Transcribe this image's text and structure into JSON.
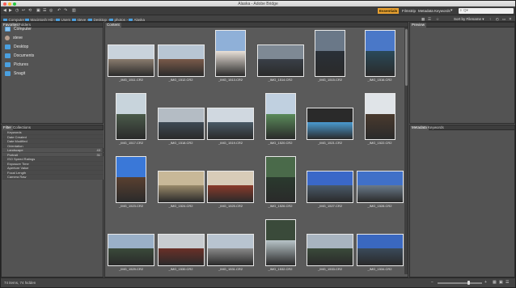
{
  "window": {
    "title": "Alaska - Adobe Bridge"
  },
  "toolbar": {
    "breadcrumbs": [
      "Computer",
      "Macintosh HD",
      "Users",
      "steve",
      "Desktop",
      "photos",
      "Alaska"
    ],
    "workspaces": [
      "Essentials",
      "Filmstrip",
      "Metadata",
      "Keywords"
    ],
    "active_workspace": "Essentials",
    "search_placeholder": "Q▾"
  },
  "pathbar": {
    "sort_label": "Sort by Filename ▾"
  },
  "left_top_panel": {
    "tabs": [
      "Favorites",
      "Folders"
    ],
    "items": [
      {
        "label": "Computer",
        "icon": "computer-icon"
      },
      {
        "label": "steve",
        "icon": "user-icon"
      },
      {
        "label": "Desktop",
        "icon": "folder-icon"
      },
      {
        "label": "Documents",
        "icon": "folder-icon"
      },
      {
        "label": "Pictures",
        "icon": "folder-icon"
      },
      {
        "label": "Snagit",
        "icon": "folder-icon"
      }
    ]
  },
  "left_bottom_panel": {
    "tabs": [
      "Filter",
      "Collections"
    ],
    "rows": [
      {
        "label": "Keywords",
        "count": "",
        "header": true
      },
      {
        "label": "Date Created",
        "count": "",
        "header": true
      },
      {
        "label": "Date Modified",
        "count": "",
        "header": true
      },
      {
        "label": "Orientation",
        "count": "",
        "header": true
      },
      {
        "label": "Landscape",
        "count": "43",
        "header": false
      },
      {
        "label": "Portrait",
        "count": "31",
        "header": false
      },
      {
        "label": "ISO Speed Ratings",
        "count": "",
        "header": true
      },
      {
        "label": "Exposure Time",
        "count": "",
        "header": true
      },
      {
        "label": "Aperture Value",
        "count": "",
        "header": true
      },
      {
        "label": "Focal Length",
        "count": "",
        "header": true
      },
      {
        "label": "Camera Raw",
        "count": "",
        "header": true
      }
    ]
  },
  "content_panel": {
    "tab": "Content",
    "thumbnails": [
      {
        "label": "_IMG_1511.CR2",
        "orientation": "landscape",
        "sky": "#c9d3dc",
        "ground": "#8a7c6e"
      },
      {
        "label": "_IMG_1512.CR2",
        "orientation": "landscape",
        "sky": "#b8c6d4",
        "ground": "#7a5a4a"
      },
      {
        "label": "_IMG_1513.CR2",
        "orientation": "portrait",
        "sky": "#8fb0d8",
        "ground": "#e8e0d8"
      },
      {
        "label": "_IMG_1514.CR2",
        "orientation": "landscape",
        "sky": "#7e8994",
        "ground": "#3a4048"
      },
      {
        "label": "_IMG_1515.CR2",
        "orientation": "portrait",
        "sky": "#6a7888",
        "ground": "#2a3038"
      },
      {
        "label": "_IMG_1516.CR2",
        "orientation": "portrait",
        "sky": "#4a78c8",
        "ground": "#2a4a5a"
      },
      {
        "label": "_IMG_1517.CR2",
        "orientation": "portrait",
        "sky": "#c8d4dc",
        "ground": "#4a5a4a"
      },
      {
        "label": "_IMG_1518.CR2",
        "orientation": "landscape",
        "sky": "#b4bcc4",
        "ground": "#3e4a54"
      },
      {
        "label": "_IMG_1519.CR2",
        "orientation": "landscape",
        "sky": "#d0d8e0",
        "ground": "#4a5a66"
      },
      {
        "label": "_IMG_1520.CR2",
        "orientation": "portrait",
        "sky": "#c0d0e0",
        "ground": "#5a8a5a"
      },
      {
        "label": "_IMG_1521.CR2",
        "orientation": "landscape",
        "sky": "#2a2a2a",
        "ground": "#4a9ad0"
      },
      {
        "label": "_IMG_1522.CR2",
        "orientation": "portrait",
        "sky": "#e0e4e8",
        "ground": "#4a3a2e"
      },
      {
        "label": "_IMG_1523.CR2",
        "orientation": "portrait",
        "sky": "#3a78d8",
        "ground": "#5a4030"
      },
      {
        "label": "_IMG_1524.CR2",
        "orientation": "landscape",
        "sky": "#c8b898",
        "ground": "#9a8a6a"
      },
      {
        "label": "_IMG_1525.CR2",
        "orientation": "landscape",
        "sky": "#d8ccb8",
        "ground": "#8a3a2a"
      },
      {
        "label": "_IMG_1526.CR2",
        "orientation": "portrait",
        "sky": "#4a6a4a",
        "ground": "#2a3a2e"
      },
      {
        "label": "_IMG_1527.CR2",
        "orientation": "landscape",
        "sky": "#3a68c8",
        "ground": "#4a5a6a"
      },
      {
        "label": "_IMG_1528.CR2",
        "orientation": "landscape",
        "sky": "#4070c8",
        "ground": "#6a7a8a"
      },
      {
        "label": "_IMG_1529.CR2",
        "orientation": "landscape",
        "sky": "#9ab0c8",
        "ground": "#3a4a3a"
      },
      {
        "label": "_IMG_1530.CR2",
        "orientation": "landscape",
        "sky": "#c8ccd0",
        "ground": "#6a3028"
      },
      {
        "label": "_IMG_1531.CR2",
        "orientation": "landscape",
        "sky": "#b8c4d0",
        "ground": "#8a8a8a"
      },
      {
        "label": "_IMG_1532.CR2",
        "orientation": "portrait",
        "sky": "#3a4a3a",
        "ground": "#b8c4c8"
      },
      {
        "label": "_IMG_1533.CR2",
        "orientation": "landscape",
        "sky": "#a8b4c0",
        "ground": "#3a4a3a"
      },
      {
        "label": "_IMG_1534.CR2",
        "orientation": "landscape",
        "sky": "#3a68c0",
        "ground": "#3a4a5a"
      }
    ]
  },
  "right_top_panel": {
    "tabs": [
      "Preview"
    ]
  },
  "right_bottom_panel": {
    "tabs": [
      "Metadata",
      "Keywords"
    ]
  },
  "statusbar": {
    "text": "74 items, 74 hidden"
  },
  "colors": {
    "accent": "#e8a030",
    "panel": "#535353",
    "content_bg": "#5a5a5a"
  }
}
